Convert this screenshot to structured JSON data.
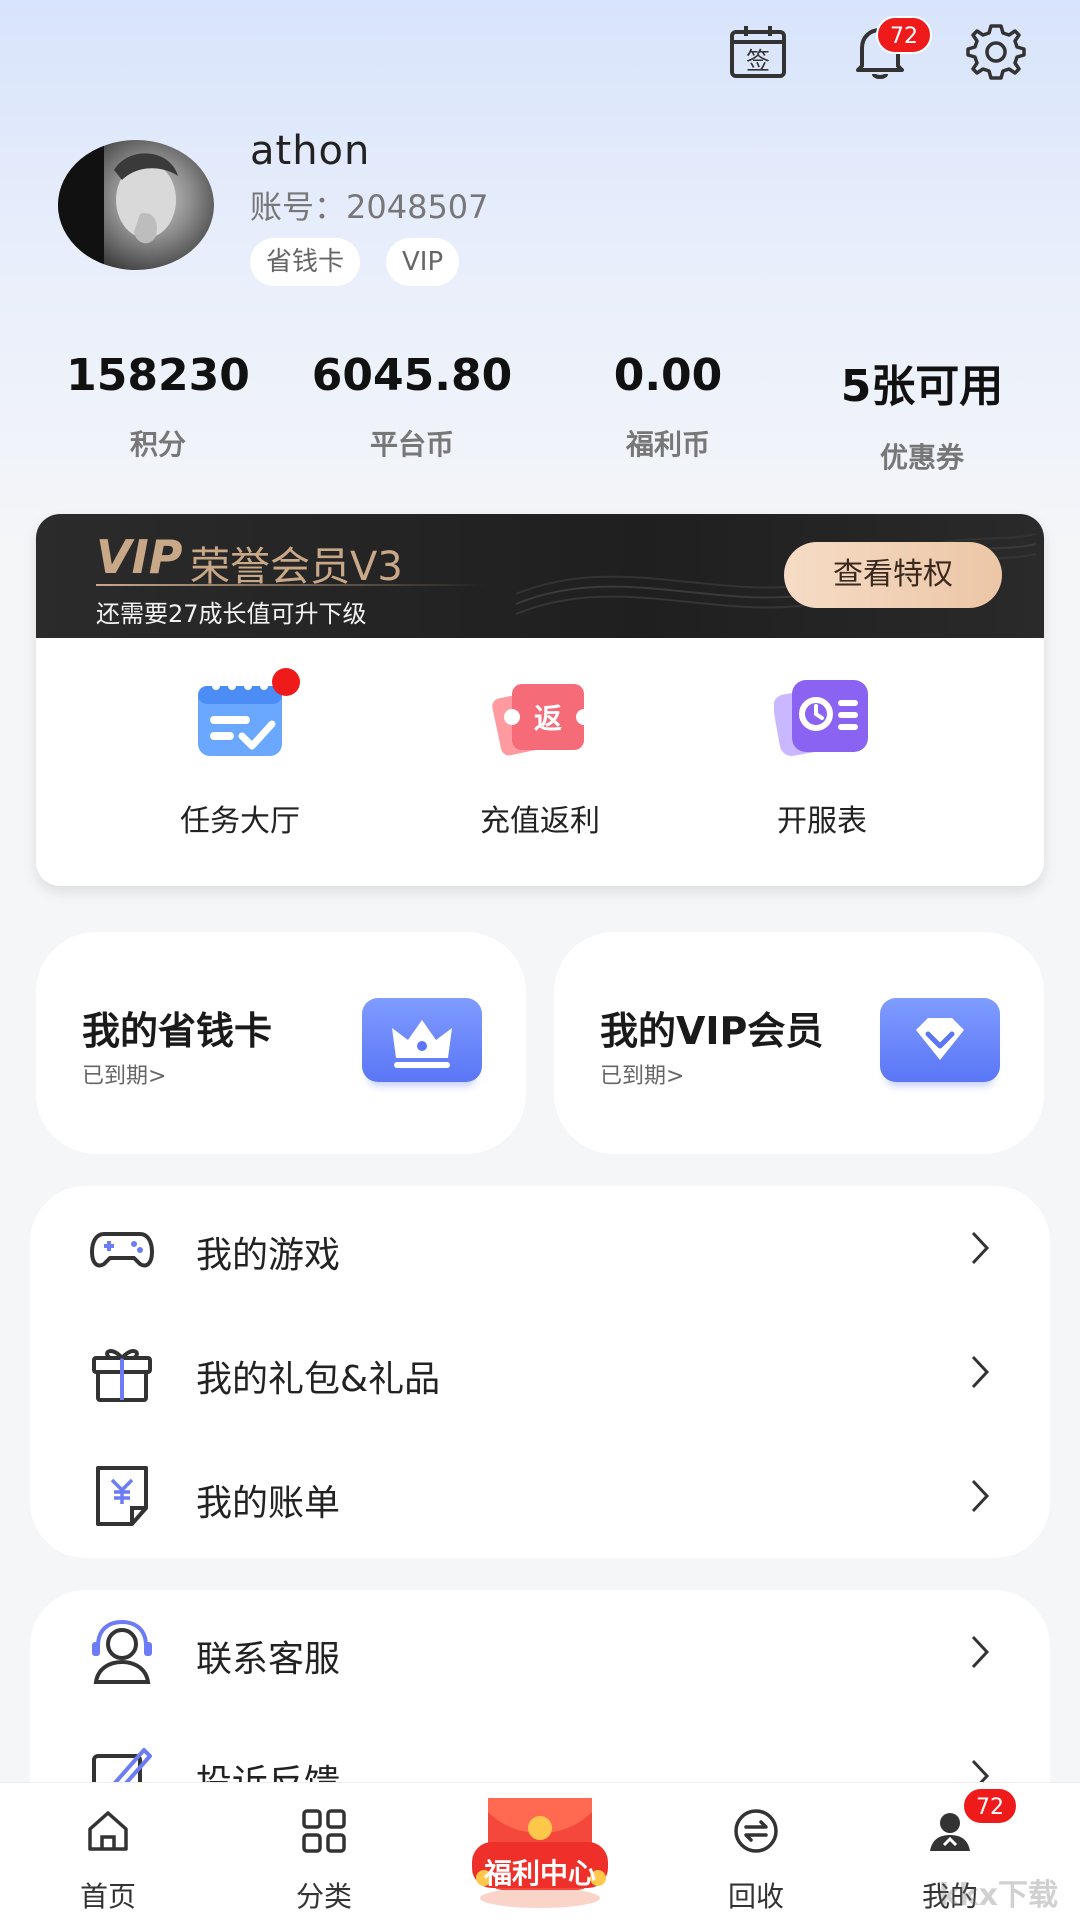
{
  "header": {
    "notification_count": "72"
  },
  "profile": {
    "username": "athon",
    "account": "账号：2048507",
    "tags": [
      "省钱卡",
      "VIP"
    ]
  },
  "stats": [
    {
      "value": "158230",
      "label": "积分"
    },
    {
      "value": "6045.80",
      "label": "平台币"
    },
    {
      "value": "0.00",
      "label": "福利币"
    },
    {
      "value": "5张可用",
      "label": "优惠券"
    }
  ],
  "vip": {
    "logo": "VIP",
    "title": "荣誉会员V3",
    "subtitle": "还需要27成长值可升下级",
    "button": "查看特权"
  },
  "features": [
    {
      "label": "任务大厅",
      "icon": "task-calendar-icon"
    },
    {
      "label": "充值返利",
      "icon": "rebate-ticket-icon"
    },
    {
      "label": "开服表",
      "icon": "server-schedule-icon"
    }
  ],
  "cards": [
    {
      "title": "我的省钱卡",
      "sub": "已到期>",
      "icon": "crown-icon"
    },
    {
      "title": "我的VIP会员",
      "sub": "已到期>",
      "icon": "diamond-icon"
    }
  ],
  "menu1": [
    {
      "label": "我的游戏",
      "icon": "gamepad-icon"
    },
    {
      "label": "我的礼包&礼品",
      "icon": "gift-icon"
    },
    {
      "label": "我的账单",
      "icon": "bill-icon"
    }
  ],
  "menu2": [
    {
      "label": "联系客服",
      "icon": "headset-icon"
    },
    {
      "label": "投诉反馈",
      "icon": "feedback-edit-icon"
    }
  ],
  "nav": {
    "home": "首页",
    "category": "分类",
    "welfare": "福利中心",
    "recycle": "回收",
    "mine": "我的",
    "mine_badge": "72"
  },
  "watermark": "kkx下载"
}
